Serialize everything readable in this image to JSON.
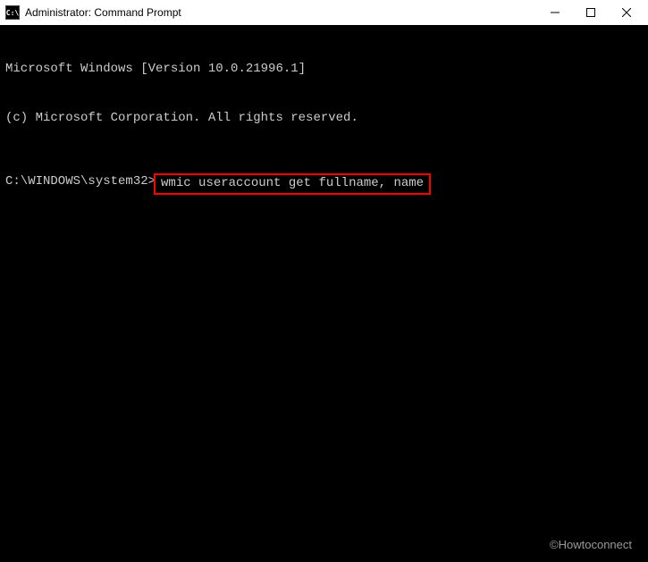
{
  "titlebar": {
    "icon_text": "C:\\",
    "title": "Administrator: Command Prompt"
  },
  "terminal": {
    "line1": "Microsoft Windows [Version 10.0.21996.1]",
    "line2": "(c) Microsoft Corporation. All rights reserved.",
    "prompt": "C:\\WINDOWS\\system32>",
    "command": "wmic useraccount get fullname, name"
  },
  "watermark": "©Howtoconnect"
}
